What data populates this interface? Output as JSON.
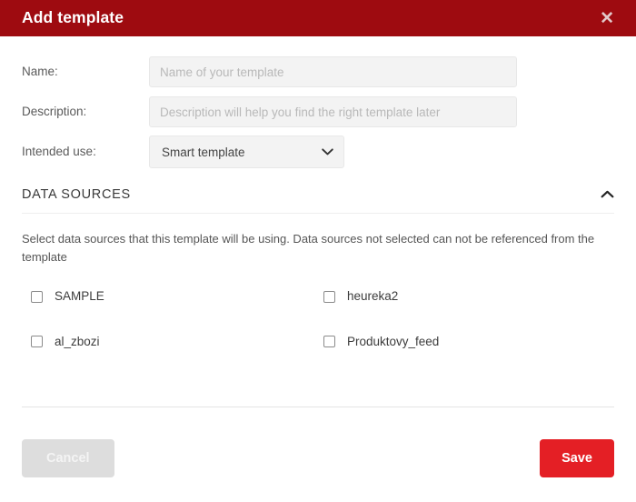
{
  "dialog": {
    "title": "Add template",
    "close_icon": "close-icon"
  },
  "form": {
    "fields": [
      {
        "label": "Name:",
        "placeholder": "Name of your template",
        "value": ""
      },
      {
        "label": "Description:",
        "placeholder": "Description will help you find the right template later",
        "value": ""
      }
    ],
    "intended_use": {
      "label": "Intended use:",
      "selected": "Smart template",
      "caret_icon": "chevron-down-icon"
    }
  },
  "data_sources": {
    "title": "DATA SOURCES",
    "toggle_icon": "chevron-up-icon",
    "description": "Select data sources that this template will be using. Data sources not selected can not be referenced from the template",
    "items": [
      {
        "label": "SAMPLE",
        "checked": false
      },
      {
        "label": "heureka2",
        "checked": false
      },
      {
        "label": "al_zbozi",
        "checked": false
      },
      {
        "label": "Produktovy_feed",
        "checked": false
      }
    ]
  },
  "footer": {
    "cancel_label": "Cancel",
    "save_label": "Save"
  },
  "colors": {
    "header_red": "#9e0b10",
    "save_red": "#e41f25",
    "cancel_gray": "#dddddd",
    "field_gray": "#f3f3f3"
  }
}
